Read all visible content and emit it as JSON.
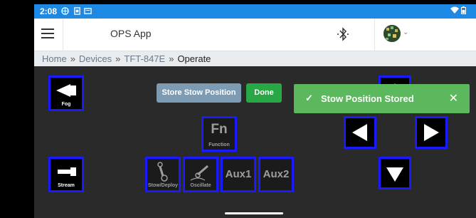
{
  "status_bar": {
    "time": "2:08"
  },
  "app_bar": {
    "title": "OPS App"
  },
  "breadcrumb": {
    "items": [
      "Home",
      "Devices",
      "TFT-847E",
      "Operate"
    ],
    "separator": "»"
  },
  "controls": {
    "fog_label": "Fog",
    "stream_label": "Stream",
    "function_big": "Fn",
    "function_label": "Function",
    "stow_deploy_label": "Stow/Deploy",
    "oscillate_label": "Oscillate",
    "aux1_label": "Aux1",
    "aux2_label": "Aux2"
  },
  "actions": {
    "store_label": "Store Stow Position",
    "done_label": "Done"
  },
  "toast": {
    "message": "Stow Position Stored",
    "close": "✕",
    "check": "✓"
  },
  "colors": {
    "status_bar": "#1e88e5",
    "button_border": "#1a1aff",
    "toast": "#5cb85c",
    "done": "#28a745",
    "store": "#7d9cb4"
  },
  "icons": [
    "menu-icon",
    "bluetooth-icon",
    "avatar-icon",
    "chevron-down-icon",
    "arrow-left-icon",
    "arrow-right-icon",
    "arrow-down-icon",
    "arrow-up-icon",
    "check-icon",
    "close-icon"
  ]
}
